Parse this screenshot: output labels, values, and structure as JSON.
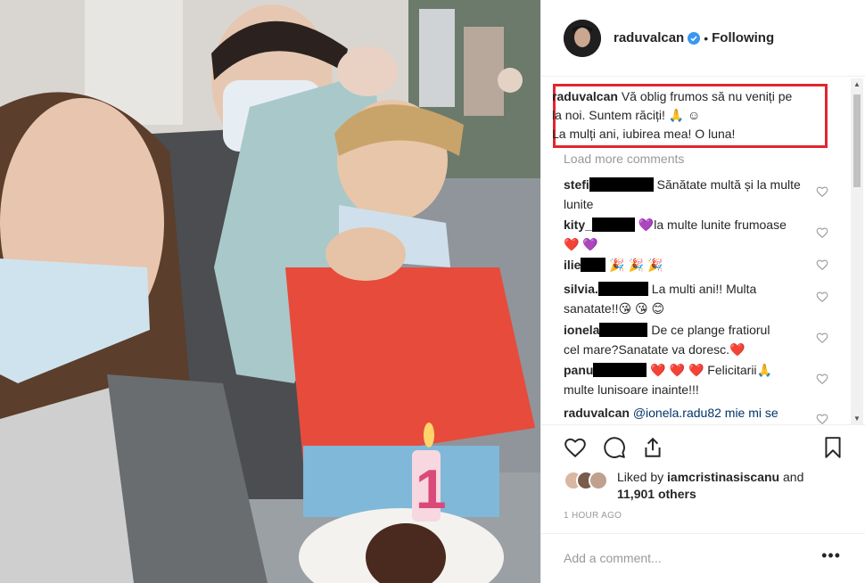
{
  "post": {
    "username": "raduvalcan",
    "follow_status": "Following",
    "caption_user": "raduvalcan",
    "caption_line1": "Vă oblig frumos să nu veniți pe",
    "caption_line2": "la noi. Suntem răciți! 🙏 ☺",
    "caption_line3": "La mulți ani, iubirea mea! O luna!",
    "load_more": "Load more comments",
    "comments": [
      {
        "user": "stefi",
        "text_a": " Sănătate multă și la multe",
        "text_b": "lunite"
      },
      {
        "user": "kity_",
        "text_a": " 💜la multe lunite frumoase",
        "text_b": "❤️ 💜"
      },
      {
        "user": "ilie",
        "text_a": " 🎉 🎉 🎉",
        "text_b": ""
      },
      {
        "user": "silvia.",
        "text_a": " La multi ani!! Multa",
        "text_b": "sanatate!!😘 😘 😊"
      },
      {
        "user": "ionela",
        "text_a": " De ce plange fratiorul",
        "text_b": "cel mare?Sanatate va doresc.❤️"
      },
      {
        "user": "panu",
        "text_a": " ❤️ ❤️ ❤️ Felicitarii🙏",
        "text_b": "multe lunisoare inainte!!!"
      },
      {
        "user": "raduvalcan",
        "text_a": " @ionela.radu82 mie mi se",
        "text_b": ""
      }
    ],
    "liked_by_prefix": "Liked by",
    "liked_by_user": "iamcristinasiscanu",
    "liked_by_and": "and",
    "liked_by_others": "11,901 others",
    "time": "1 HOUR AGO",
    "add_comment_placeholder": "Add a comment...",
    "more_label": "•••"
  },
  "colors": {
    "highlight_border": "#e0262e",
    "verified": "#3897f0",
    "muted": "#999999"
  }
}
